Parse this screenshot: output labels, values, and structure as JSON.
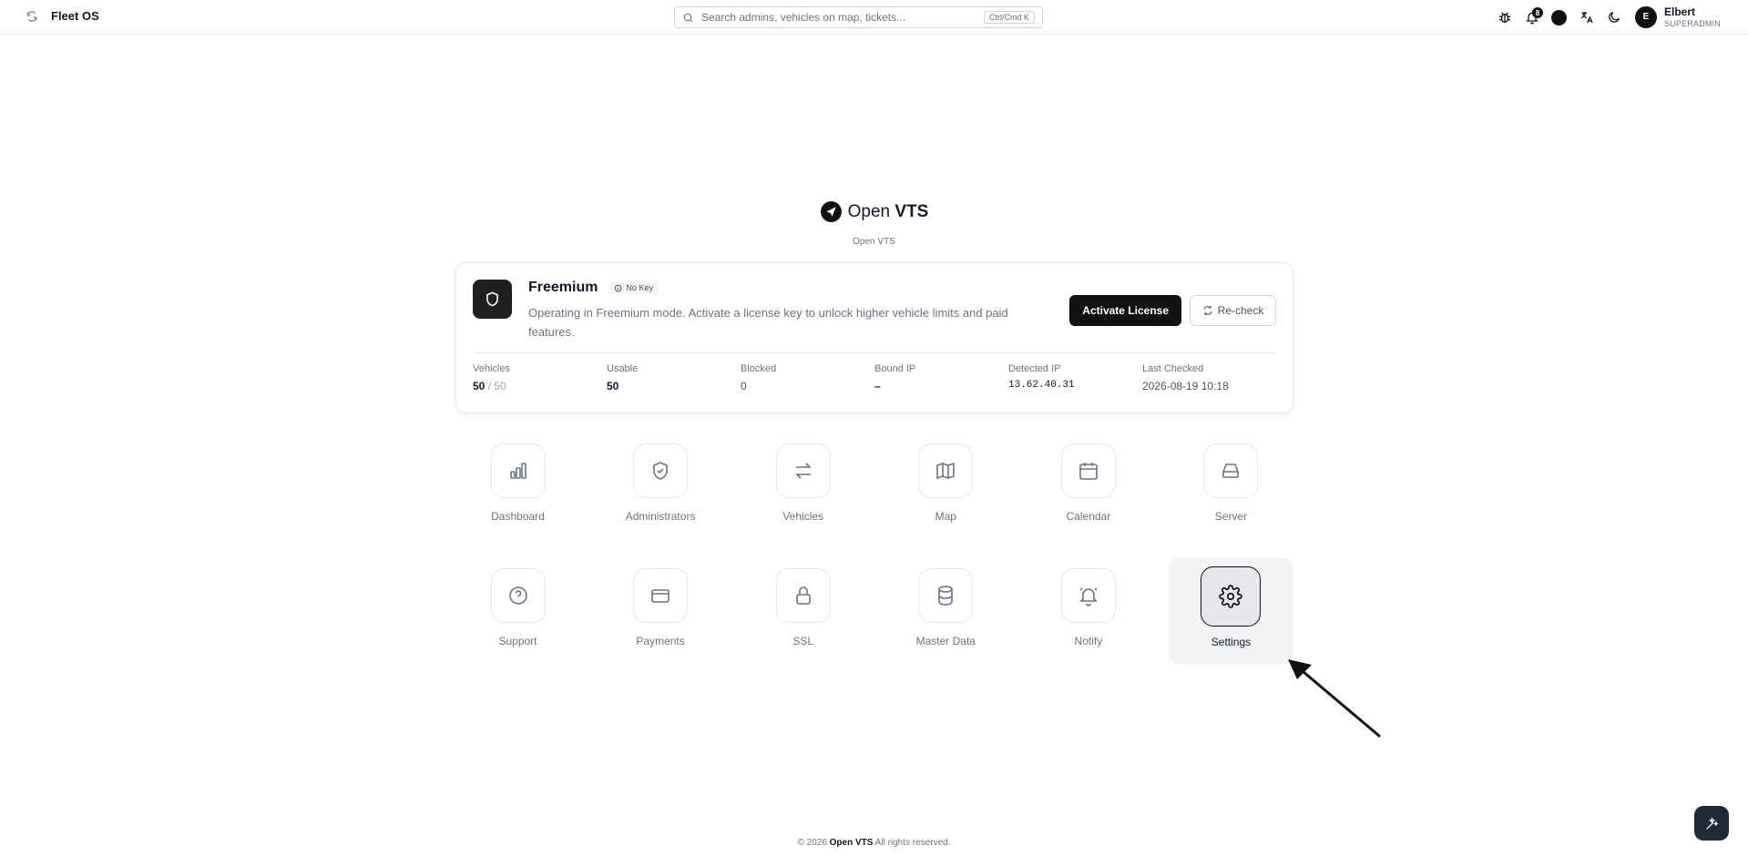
{
  "app": {
    "name": "Fleet OS"
  },
  "search": {
    "placeholder": "Search admins, vehicles on map, tickets...",
    "shortcut": "Ctrl/Cmd K"
  },
  "notifications": {
    "count": "8"
  },
  "user": {
    "initial": "E",
    "name": "Elbert",
    "role": "SUPERADMIN"
  },
  "brand": {
    "title_light": "Open ",
    "title_bold": "VTS",
    "subtitle": "Open VTS"
  },
  "license": {
    "plan": "Freemium",
    "key_status": "No Key",
    "description": "Operating in Freemium mode. Activate a license key to unlock higher vehicle limits and paid features.",
    "activate_label": "Activate License",
    "recheck_label": "Re-check",
    "stats": {
      "vehicles": {
        "label": "Vehicles",
        "value": "50",
        "total": "/ 50"
      },
      "usable": {
        "label": "Usable",
        "value": "50"
      },
      "blocked": {
        "label": "Blocked",
        "value": "0"
      },
      "bound_ip": {
        "label": "Bound IP",
        "value": "–"
      },
      "detected_ip": {
        "label": "Detected IP",
        "value": "13.62.40.31"
      },
      "last_checked": {
        "label": "Last Checked",
        "value": "2026-08-19 10:18"
      }
    }
  },
  "apps": [
    {
      "label": "Dashboard",
      "icon": "bar-chart-icon"
    },
    {
      "label": "Administrators",
      "icon": "shield-check-icon"
    },
    {
      "label": "Vehicles",
      "icon": "arrows-exchange-icon"
    },
    {
      "label": "Map",
      "icon": "map-icon"
    },
    {
      "label": "Calendar",
      "icon": "calendar-icon"
    },
    {
      "label": "Server",
      "icon": "hard-drive-icon"
    },
    {
      "label": "Support",
      "icon": "help-circle-icon"
    },
    {
      "label": "Payments",
      "icon": "credit-card-icon"
    },
    {
      "label": "SSL",
      "icon": "lock-icon"
    },
    {
      "label": "Master Data",
      "icon": "database-icon"
    },
    {
      "label": "Notify",
      "icon": "bell-ring-icon"
    },
    {
      "label": "Settings",
      "icon": "gear-icon",
      "active": true
    }
  ],
  "footer": {
    "prefix": "© 2026 ",
    "brand": "Open VTS",
    "suffix": " All rights reserved."
  },
  "colors": {
    "accent": "#111111",
    "muted": "#6b7280",
    "border": "#e5e7eb",
    "active_tile_bg": "#f3f4f6"
  }
}
